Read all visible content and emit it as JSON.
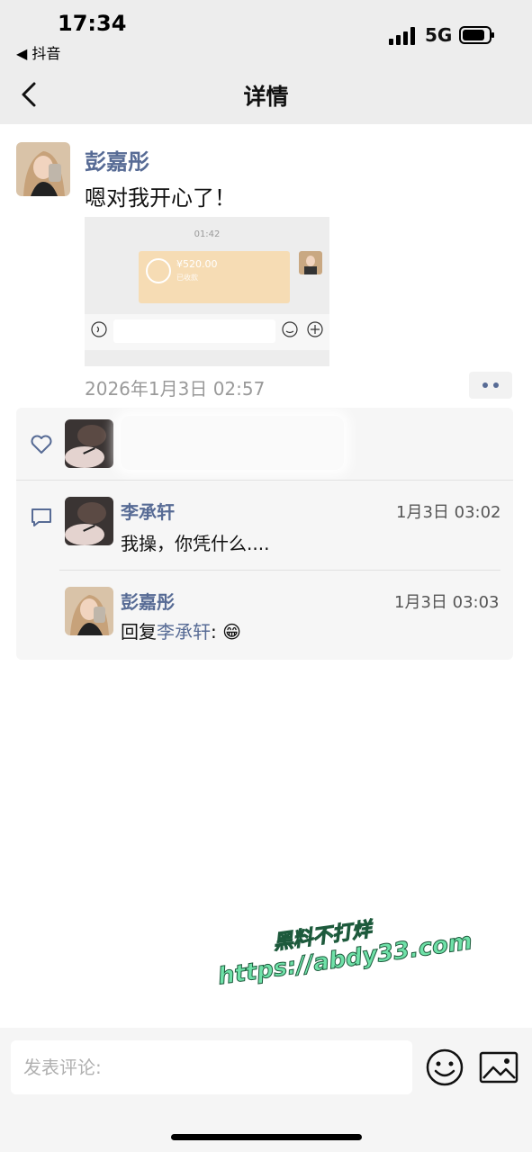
{
  "status_bar": {
    "time": "17:34",
    "back_app": "◀ 抖音",
    "network": "5G"
  },
  "nav": {
    "title": "详情"
  },
  "post": {
    "author": "彭嘉彤",
    "text": "嗯对我开心了！",
    "timestamp": "2026年1月3日 02:57",
    "screenshot": {
      "time": "01:42",
      "amount": "¥520.00",
      "status": "已收款"
    }
  },
  "comments": [
    {
      "author": "李承轩",
      "time": "1月3日 03:02",
      "text": "我操，你凭什么...."
    },
    {
      "author": "彭嘉彤",
      "time": "1月3日 03:03",
      "reply_prefix": "回复",
      "reply_to": "李承轩",
      "reply_suffix": ":",
      "emoji": "😁"
    }
  ],
  "composer": {
    "placeholder": "发表评论:"
  },
  "watermark": {
    "line1": "黑料不打烊",
    "line2": "https://abdy33.com"
  },
  "colors": {
    "link": "#576b95",
    "panel": "#f6f6f6",
    "topbar": "#ededed"
  }
}
